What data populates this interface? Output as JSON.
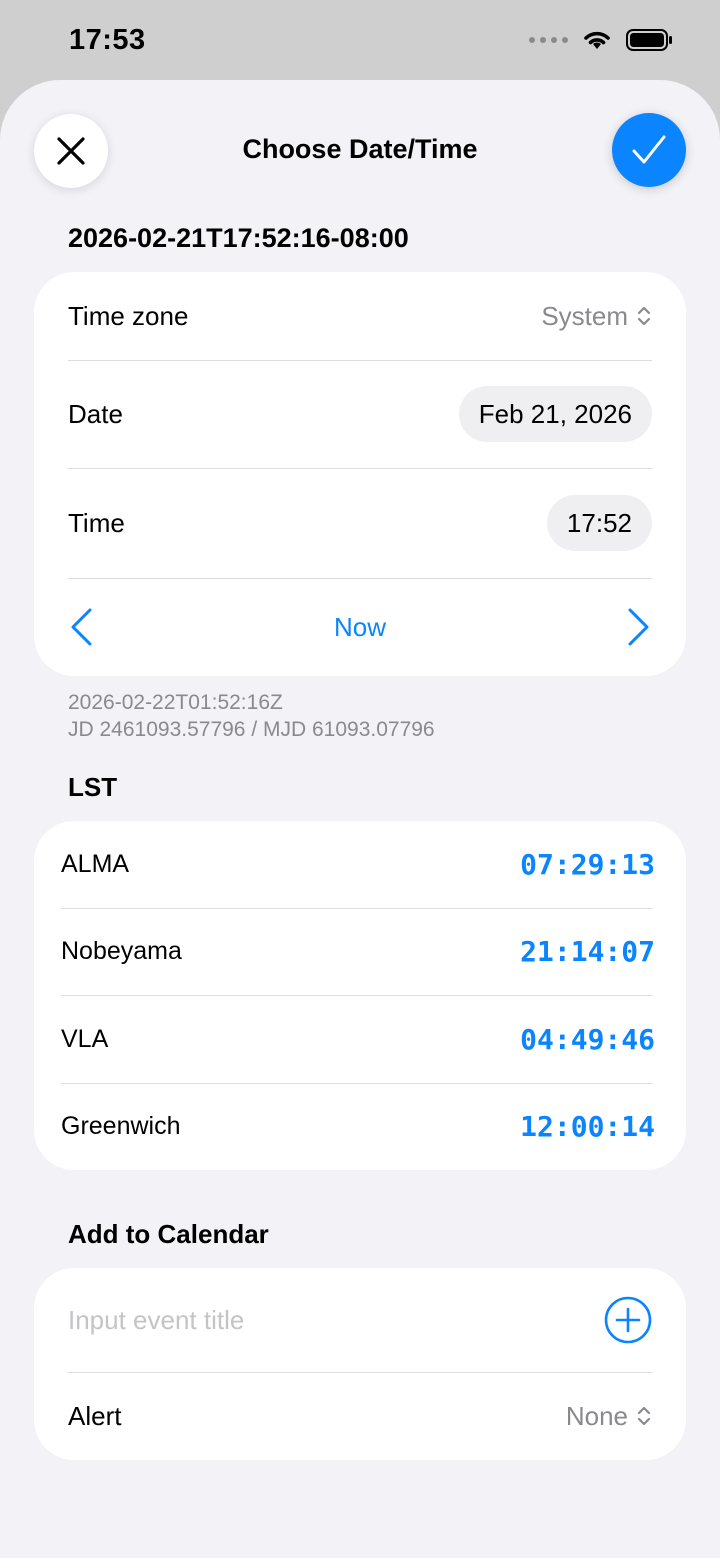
{
  "status_bar": {
    "time": "17:53"
  },
  "nav": {
    "title": "Choose Date/Time",
    "close_icon": "close-icon",
    "confirm_icon": "checkmark-icon"
  },
  "iso_local": "2026-02-21T17:52:16-08:00",
  "datetime": {
    "timezone_label": "Time zone",
    "timezone_value": "System",
    "date_label": "Date",
    "date_value": "Feb 21, 2026",
    "time_label": "Time",
    "time_value": "17:52",
    "now_label": "Now"
  },
  "meta": {
    "utc": "2026-02-22T01:52:16Z",
    "jd_mjd": "JD 2461093.57796 / MJD 61093.07796"
  },
  "lst": {
    "title": "LST",
    "rows": [
      {
        "name": "ALMA",
        "value": "07:29:13"
      },
      {
        "name": "Nobeyama",
        "value": "21:14:07"
      },
      {
        "name": "VLA",
        "value": "04:49:46"
      },
      {
        "name": "Greenwich",
        "value": "12:00:14"
      }
    ]
  },
  "calendar": {
    "title": "Add to Calendar",
    "event_placeholder": "Input event title",
    "event_value": "",
    "alert_label": "Alert",
    "alert_value": "None"
  },
  "colors": {
    "accent": "#0a84ff",
    "sheet_bg": "#f2f2f7",
    "secondary_text": "#8a8a8e"
  }
}
